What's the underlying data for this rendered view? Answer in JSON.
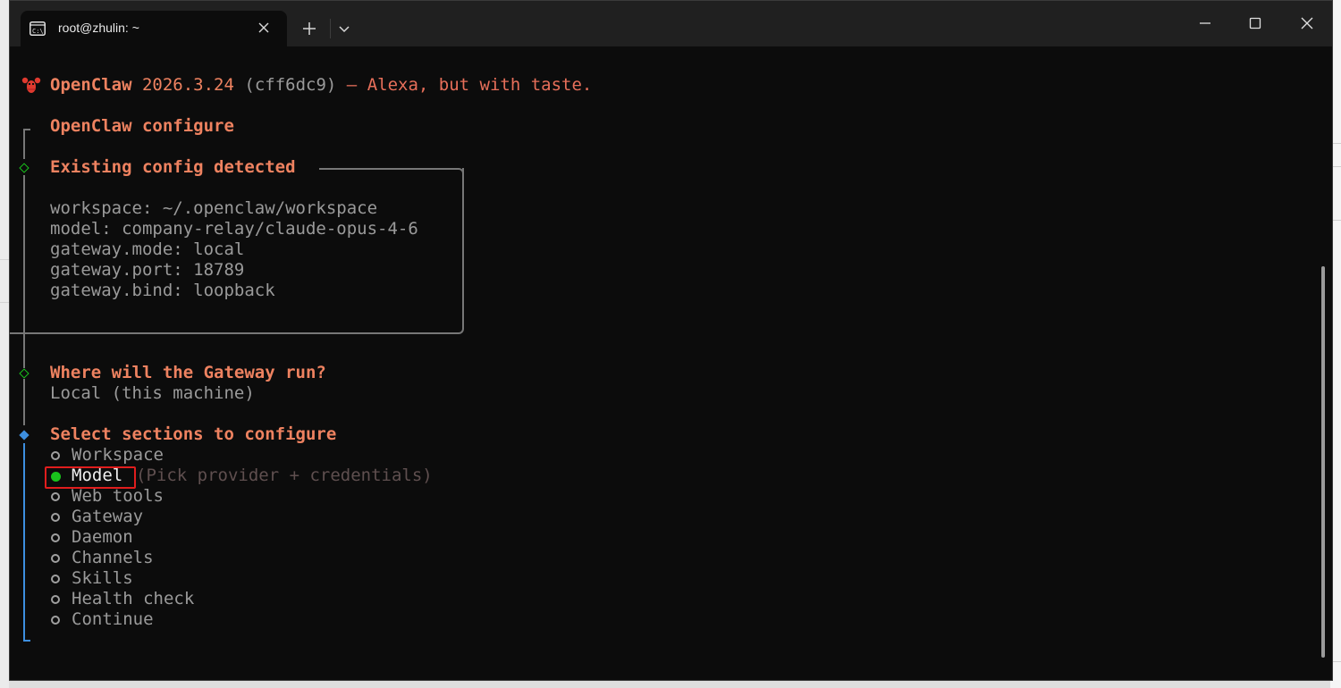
{
  "tab": {
    "title": "root@zhulin: ~",
    "icon": "terminal-icon"
  },
  "header": {
    "app": "OpenClaw",
    "version": "2026.3.24",
    "hash": "(cff6dc9)",
    "dash": "—",
    "tagline": "Alexa, but with taste.",
    "logo": "lobster-icon"
  },
  "configure_title": "OpenClaw configure",
  "existing": {
    "title": "Existing config detected",
    "lines": [
      "workspace: ~/.openclaw/workspace",
      "model: company-relay/claude-opus-4-6",
      "gateway.mode: local",
      "gateway.port: 18789",
      "gateway.bind: loopback"
    ]
  },
  "gateway_question": {
    "title": "Where will the Gateway run?",
    "answer": "Local (this machine)"
  },
  "sections": {
    "title": "Select sections to configure",
    "items": [
      {
        "label": "Workspace",
        "selected": false,
        "hint": ""
      },
      {
        "label": "Model",
        "selected": true,
        "hint": "(Pick provider + credentials)"
      },
      {
        "label": "Web tools",
        "selected": false,
        "hint": ""
      },
      {
        "label": "Gateway",
        "selected": false,
        "hint": ""
      },
      {
        "label": "Daemon",
        "selected": false,
        "hint": ""
      },
      {
        "label": "Channels",
        "selected": false,
        "hint": ""
      },
      {
        "label": "Skills",
        "selected": false,
        "hint": ""
      },
      {
        "label": "Health check",
        "selected": false,
        "hint": ""
      },
      {
        "label": "Continue",
        "selected": false,
        "hint": ""
      }
    ]
  },
  "colors": {
    "accent": "#ee8260",
    "active": "#3d8fe0",
    "done": "#19c41c",
    "highlight": "#e01d1d"
  }
}
